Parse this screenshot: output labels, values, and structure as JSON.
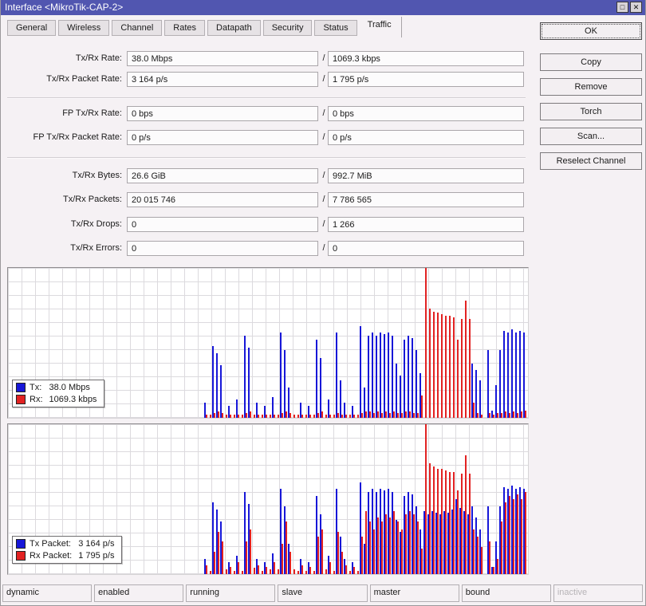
{
  "window": {
    "title": "Interface <MikroTik-CAP-2>",
    "maximize_glyph": "□",
    "close_glyph": "✕"
  },
  "tabs": [
    {
      "label": "General",
      "active": false
    },
    {
      "label": "Wireless",
      "active": false
    },
    {
      "label": "Channel",
      "active": false
    },
    {
      "label": "Rates",
      "active": false
    },
    {
      "label": "Datapath",
      "active": false
    },
    {
      "label": "Security",
      "active": false
    },
    {
      "label": "Status",
      "active": false
    },
    {
      "label": "Traffic",
      "active": true
    }
  ],
  "field_separator": "/",
  "fields": [
    {
      "name": "tx-rx-rate",
      "label": "Tx/Rx Rate:",
      "tx": "38.0 Mbps",
      "rx": "1069.3 kbps"
    },
    {
      "name": "tx-rx-packet-rate",
      "label": "Tx/Rx Packet Rate:",
      "tx": "3 164 p/s",
      "rx": "1 795 p/s"
    },
    {
      "name": "fp-tx-rx-rate",
      "label": "FP Tx/Rx Rate:",
      "tx": "0 bps",
      "rx": "0 bps"
    },
    {
      "name": "fp-tx-rx-packet-rate",
      "label": "FP Tx/Rx Packet Rate:",
      "tx": "0 p/s",
      "rx": "0 p/s"
    },
    {
      "name": "tx-rx-bytes",
      "label": "Tx/Rx Bytes:",
      "tx": "26.6 GiB",
      "rx": "992.7 MiB"
    },
    {
      "name": "tx-rx-packets",
      "label": "Tx/Rx Packets:",
      "tx": "20 015 746",
      "rx": "7 786 565"
    },
    {
      "name": "tx-rx-drops",
      "label": "Tx/Rx Drops:",
      "tx": "0",
      "rx": "1 266"
    },
    {
      "name": "tx-rx-errors",
      "label": "Tx/Rx Errors:",
      "tx": "0",
      "rx": "0"
    }
  ],
  "buttons": [
    {
      "label": "OK",
      "default": true
    },
    {
      "label": "Copy",
      "default": false
    },
    {
      "label": "Remove",
      "default": false
    },
    {
      "label": "Torch",
      "default": false
    },
    {
      "label": "Scan...",
      "default": false
    },
    {
      "label": "Reselect Channel",
      "default": false
    }
  ],
  "status_bar": [
    {
      "label": "dynamic",
      "muted": false
    },
    {
      "label": "enabled",
      "muted": false
    },
    {
      "label": "running",
      "muted": false
    },
    {
      "label": "slave",
      "muted": false
    },
    {
      "label": "master",
      "muted": false
    },
    {
      "label": "bound",
      "muted": false
    },
    {
      "label": "inactive",
      "muted": true
    }
  ],
  "colors": {
    "titlebar": "#5156b0",
    "tx": "#1717d8",
    "rx": "#e22222",
    "chart_bg": "#ffffff",
    "grid": "#dcdade"
  },
  "chart_data": [
    {
      "type": "bar",
      "title": "Tx/Rx rate history",
      "units": "fraction-of-chart-height",
      "ylim": [
        0,
        1
      ],
      "grid": true,
      "legend_position": "bottom-left",
      "legend": [
        {
          "label": "Tx:",
          "value": "38.0 Mbps",
          "color": "#1717d8"
        },
        {
          "label": "Rx:",
          "value": "1069.3 kbps",
          "color": "#e22222"
        }
      ],
      "series": [
        {
          "name": "tx",
          "color": "#1717d8",
          "values": [
            0,
            0,
            0,
            0,
            0,
            0,
            0,
            0,
            0,
            0,
            0,
            0,
            0,
            0,
            0,
            0,
            0,
            0,
            0,
            0,
            0,
            0,
            0,
            0,
            0,
            0,
            0,
            0,
            0,
            0,
            0,
            0,
            0,
            0,
            0,
            0,
            0,
            0,
            0,
            0,
            0,
            0,
            0,
            0,
            0,
            0,
            0,
            0,
            0,
            0.1,
            0,
            0.48,
            0.43,
            0.35,
            0,
            0.08,
            0,
            0.12,
            0,
            0.55,
            0.47,
            0,
            0.1,
            0,
            0.08,
            0,
            0.14,
            0,
            0.57,
            0.45,
            0.2,
            0,
            0,
            0.1,
            0,
            0.08,
            0,
            0.52,
            0.4,
            0,
            0.12,
            0,
            0.57,
            0.25,
            0.1,
            0,
            0.08,
            0,
            0.61,
            0.2,
            0.55,
            0.57,
            0.55,
            0.57,
            0.56,
            0.57,
            0.55,
            0.36,
            0.28,
            0.52,
            0.55,
            0.53,
            0.45,
            0.3,
            0,
            0,
            0,
            0,
            0,
            0,
            0,
            0,
            0,
            0,
            0,
            0,
            0.36,
            0.32,
            0.25,
            0,
            0.45,
            0.05,
            0.22,
            0.45,
            0.58,
            0.57,
            0.59,
            0.57,
            0.58,
            0.57
          ]
        },
        {
          "name": "rx",
          "color": "#e22222",
          "values": [
            0,
            0,
            0,
            0,
            0,
            0,
            0,
            0,
            0,
            0,
            0,
            0,
            0,
            0,
            0,
            0,
            0,
            0,
            0,
            0,
            0,
            0,
            0,
            0,
            0,
            0,
            0,
            0,
            0,
            0,
            0,
            0,
            0,
            0,
            0,
            0,
            0,
            0,
            0,
            0,
            0,
            0,
            0,
            0,
            0,
            0,
            0,
            0,
            0,
            0.02,
            0.02,
            0.03,
            0.04,
            0.03,
            0.02,
            0.02,
            0.02,
            0.02,
            0.02,
            0.03,
            0.04,
            0.02,
            0.02,
            0.02,
            0.02,
            0.02,
            0.02,
            0.02,
            0.03,
            0.04,
            0.03,
            0.02,
            0.02,
            0.02,
            0.02,
            0.02,
            0.02,
            0.03,
            0.04,
            0.02,
            0.02,
            0.02,
            0.03,
            0.02,
            0.02,
            0.02,
            0.02,
            0.02,
            0.03,
            0.04,
            0.04,
            0.03,
            0.04,
            0.03,
            0.04,
            0.03,
            0.04,
            0.03,
            0.03,
            0.04,
            0.04,
            0.03,
            0.03,
            0.15,
            1.0,
            0.73,
            0.71,
            0.7,
            0.69,
            0.68,
            0.68,
            0.67,
            0.52,
            0.66,
            0.78,
            0.66,
            0.1,
            0.03,
            0.02,
            0,
            0.03,
            0.02,
            0.03,
            0.03,
            0.04,
            0.03,
            0.04,
            0.03,
            0.04,
            0.05
          ]
        }
      ]
    },
    {
      "type": "bar",
      "title": "Tx/Rx packet rate history",
      "units": "fraction-of-chart-height",
      "ylim": [
        0,
        1
      ],
      "grid": true,
      "legend_position": "bottom-left",
      "legend": [
        {
          "label": "Tx Packet:",
          "value": "3 164 p/s",
          "color": "#1717d8"
        },
        {
          "label": "Rx Packet:",
          "value": "1 795 p/s",
          "color": "#e22222"
        }
      ],
      "series": [
        {
          "name": "tx-packet",
          "color": "#1717d8",
          "values": [
            0,
            0,
            0,
            0,
            0,
            0,
            0,
            0,
            0,
            0,
            0,
            0,
            0,
            0,
            0,
            0,
            0,
            0,
            0,
            0,
            0,
            0,
            0,
            0,
            0,
            0,
            0,
            0,
            0,
            0,
            0,
            0,
            0,
            0,
            0,
            0,
            0,
            0,
            0,
            0,
            0,
            0,
            0,
            0,
            0,
            0,
            0,
            0,
            0,
            0.1,
            0,
            0.48,
            0.43,
            0.35,
            0,
            0.08,
            0,
            0.12,
            0,
            0.55,
            0.47,
            0,
            0.1,
            0,
            0.08,
            0,
            0.14,
            0,
            0.57,
            0.45,
            0.2,
            0,
            0,
            0.1,
            0,
            0.08,
            0,
            0.52,
            0.4,
            0,
            0.12,
            0,
            0.57,
            0.25,
            0.1,
            0,
            0.08,
            0,
            0.61,
            0.2,
            0.55,
            0.57,
            0.55,
            0.57,
            0.56,
            0.57,
            0.55,
            0.36,
            0.28,
            0.52,
            0.55,
            0.53,
            0.45,
            0.3,
            0.42,
            0.4,
            0.42,
            0.41,
            0.4,
            0.42,
            0.41,
            0.43,
            0.5,
            0.44,
            0.42,
            0.4,
            0.45,
            0.38,
            0.3,
            0,
            0.45,
            0.05,
            0.22,
            0.45,
            0.58,
            0.57,
            0.59,
            0.57,
            0.58,
            0.57
          ]
        },
        {
          "name": "rx-packet",
          "color": "#e22222",
          "values": [
            0,
            0,
            0,
            0,
            0,
            0,
            0,
            0,
            0,
            0,
            0,
            0,
            0,
            0,
            0,
            0,
            0,
            0,
            0,
            0,
            0,
            0,
            0,
            0,
            0,
            0,
            0,
            0,
            0,
            0,
            0,
            0,
            0,
            0,
            0,
            0,
            0,
            0,
            0,
            0,
            0,
            0,
            0,
            0,
            0,
            0,
            0,
            0,
            0,
            0.06,
            0.02,
            0.15,
            0.28,
            0.22,
            0.03,
            0.05,
            0.02,
            0.08,
            0.02,
            0.22,
            0.3,
            0.04,
            0.06,
            0.02,
            0.05,
            0.03,
            0.08,
            0.03,
            0.2,
            0.35,
            0.15,
            0.03,
            0.02,
            0.06,
            0.02,
            0.05,
            0.02,
            0.25,
            0.3,
            0.03,
            0.08,
            0.02,
            0.28,
            0.15,
            0.06,
            0.02,
            0.05,
            0.02,
            0.25,
            0.42,
            0.35,
            0.3,
            0.38,
            0.35,
            0.4,
            0.38,
            0.42,
            0.35,
            0.3,
            0.4,
            0.42,
            0.4,
            0.35,
            0.17,
            1.0,
            0.74,
            0.72,
            0.7,
            0.7,
            0.69,
            0.68,
            0.68,
            0.56,
            0.67,
            0.79,
            0.67,
            0.3,
            0.25,
            0.18,
            0,
            0.22,
            0.05,
            0.1,
            0.35,
            0.48,
            0.52,
            0.5,
            0.53,
            0.5,
            0.55
          ]
        }
      ]
    }
  ]
}
